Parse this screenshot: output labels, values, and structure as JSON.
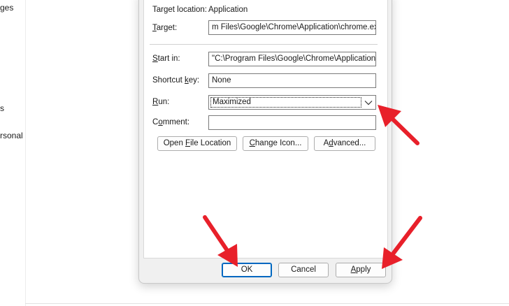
{
  "background": {
    "left_fragments": [
      "ges",
      "s",
      "rsonal"
    ]
  },
  "dialog": {
    "target_location_label": "Target location:",
    "target_location_value": "Application",
    "target_label": {
      "hot": "T",
      "rest": "arget:"
    },
    "target_value": "m Files\\Google\\Chrome\\Application\\chrome.exe\"",
    "start_in_label": {
      "hot": "S",
      "rest": "tart in:"
    },
    "start_in_value": "\"C:\\Program Files\\Google\\Chrome\\Application\"",
    "shortcut_key_label": {
      "pre": "Shortcut ",
      "hot": "k",
      "rest": "ey:"
    },
    "shortcut_key_value": "None",
    "run_label": {
      "hot": "R",
      "rest": "un:"
    },
    "run_value": "Maximized",
    "comment_label": {
      "pre": "C",
      "hot": "o",
      "rest": "mment:"
    },
    "comment_value": "",
    "buttons": {
      "open_file_location": {
        "pre": "Open ",
        "hot": "F",
        "rest": "ile Location"
      },
      "change_icon": {
        "pre": "",
        "hot": "C",
        "rest": "hange Icon..."
      },
      "advanced": {
        "pre": "A",
        "hot": "d",
        "rest": "vanced..."
      }
    },
    "footer": {
      "ok": "OK",
      "cancel": "Cancel",
      "apply": {
        "pre": "",
        "hot": "A",
        "rest": "pply"
      }
    }
  },
  "colors": {
    "annotation_arrow": "#e8202a",
    "dialog_bg": "#f0f0f0",
    "default_button_border": "#0067c0"
  },
  "icons": {
    "run_dropdown": "chevron-down-icon",
    "annotation": "red-arrow-icon"
  }
}
